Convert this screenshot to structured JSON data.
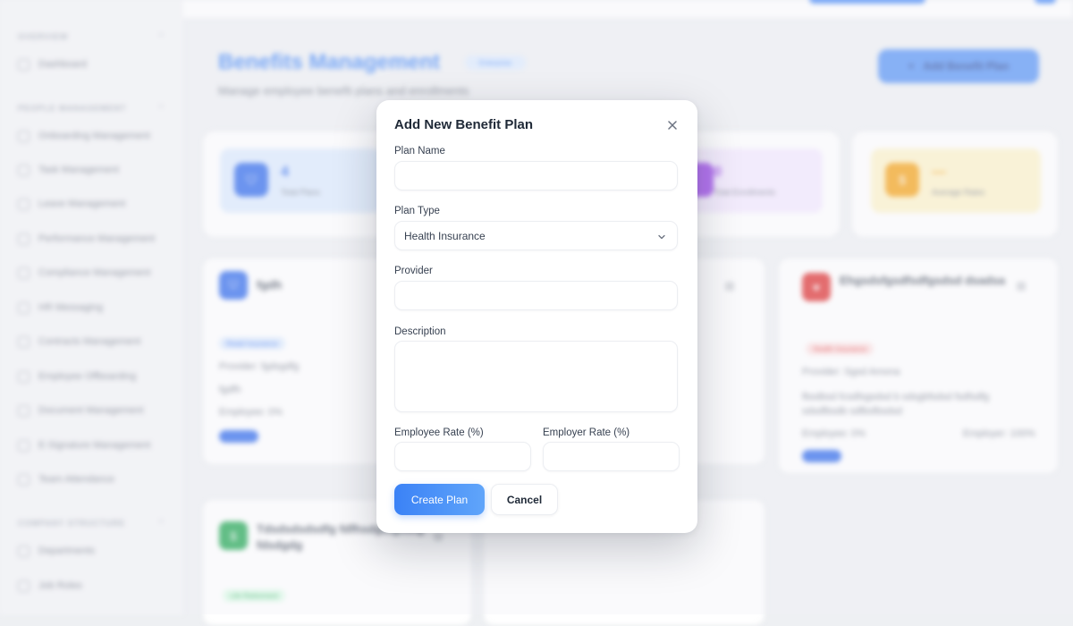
{
  "sidebar": {
    "sections": [
      {
        "label": "OVERVIEW"
      },
      {
        "label": "PEOPLE MANAGEMENT"
      },
      {
        "label": "COMPANY STRUCTURE"
      }
    ],
    "items": [
      {
        "label": "Dashboard"
      },
      {
        "label": "Onboarding Management"
      },
      {
        "label": "Task Management"
      },
      {
        "label": "Leave Management"
      },
      {
        "label": "Performance Management"
      },
      {
        "label": "Compliance Management"
      },
      {
        "label": "HR Messaging"
      },
      {
        "label": "Contracts Management"
      },
      {
        "label": "Employee Offboarding"
      },
      {
        "label": "Document Management"
      },
      {
        "label": "E-Signature Management"
      },
      {
        "label": "Team Attendance"
      },
      {
        "label": "Departments"
      },
      {
        "label": "Job Roles"
      }
    ]
  },
  "page": {
    "title": "Benefits Management",
    "badge": "Enterprise",
    "subtitle": "Manage employee benefit plans and enrollments",
    "add_button": "Add Benefit Plan"
  },
  "stats": [
    {
      "value": "4",
      "label": "Total Plans",
      "color": "#2563eb",
      "bg": "#dbeafe"
    },
    {
      "value": "0",
      "label": "Total Enrollments",
      "color": "#9333ea",
      "bg": "#f3e8ff"
    },
    {
      "value": "—",
      "label": "Average Rates",
      "color": "#f59e0b",
      "bg": "#fef3c7"
    }
  ],
  "plans": [
    {
      "title": "fgdh",
      "tag": "Retail Insurance",
      "provider": "Provider: fgdsgdfg",
      "desc": "fgdfh",
      "rate": "Employee: 0%"
    },
    {
      "title": "Ehgsdsfgsdfsdfgsdsd dsadsa",
      "tag": "Health Insurance",
      "provider": "Provider: Sgsd Amona",
      "desc": "fbsdbsd fcsdfsgsdsd b sdsgbfsdsd fsdfsdfg sdsdfbsdb sdfbsfbsdsd",
      "rate": "Employee: 0%",
      "rate2": "Employer: 100%"
    },
    {
      "title": "Tdsdsdsdsdfg fdfhsdgsfgsdfg fdsdgdg",
      "tag": "Life Retirement"
    }
  ],
  "modal": {
    "title": "Add New Benefit Plan",
    "plan_name_label": "Plan Name",
    "plan_name_value": "",
    "plan_type_label": "Plan Type",
    "plan_type_value": "Health Insurance",
    "provider_label": "Provider",
    "provider_value": "",
    "description_label": "Description",
    "description_value": "",
    "employee_rate_label": "Employee Rate (%)",
    "employee_rate_value": "",
    "employer_rate_label": "Employer Rate (%)",
    "employer_rate_value": "",
    "create_button": "Create Plan",
    "cancel_button": "Cancel"
  }
}
